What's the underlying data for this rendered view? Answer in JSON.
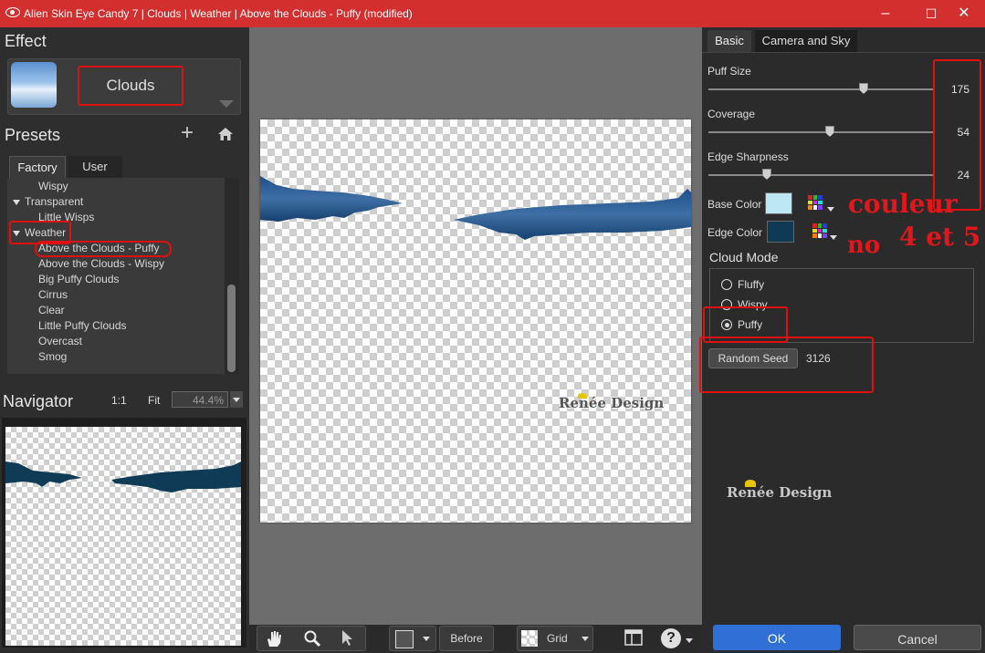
{
  "window": {
    "title": "Alien Skin Eye Candy 7 | Clouds | Weather | Above the Clouds - Puffy (modified)",
    "minimize": "–",
    "maximize": "☐",
    "close": "✕"
  },
  "left": {
    "effect_header": "Effect",
    "effect_name": "Clouds",
    "presets_header": "Presets",
    "presets_add": "+",
    "tabs": [
      "Factory",
      "User"
    ],
    "tree": [
      {
        "label": "Wispy",
        "level": 1
      },
      {
        "label": "Transparent",
        "level": 0
      },
      {
        "label": "Little Wisps",
        "level": 1
      },
      {
        "label": "Weather",
        "level": 0
      },
      {
        "label": "Above the Clouds - Puffy",
        "level": 1
      },
      {
        "label": "Above the Clouds - Wispy",
        "level": 1
      },
      {
        "label": "Big Puffy Clouds",
        "level": 1
      },
      {
        "label": "Cirrus",
        "level": 1
      },
      {
        "label": "Clear",
        "level": 1
      },
      {
        "label": "Little Puffy Clouds",
        "level": 1
      },
      {
        "label": "Overcast",
        "level": 1
      },
      {
        "label": "Smog",
        "level": 1
      }
    ],
    "navigator_header": "Navigator",
    "zoom_1to1": "1:1",
    "zoom_fit": "Fit",
    "zoom_value": "44.4%"
  },
  "canvas": {
    "watermark": "Renée Design"
  },
  "bottom": {
    "before_label": "Before",
    "grid_label": "Grid",
    "help": "?"
  },
  "right": {
    "tabs": [
      "Basic",
      "Camera and Sky"
    ],
    "sliders": [
      {
        "label": "Puff Size",
        "value": 175,
        "fraction": 0.68
      },
      {
        "label": "Coverage",
        "value": 54,
        "fraction": 0.54
      },
      {
        "label": "Edge Sharpness",
        "value": 24,
        "fraction": 0.26
      }
    ],
    "base_color_label": "Base Color",
    "base_color": "#bfe6f5",
    "edge_color_label": "Edge Color",
    "edge_color": "#0e3a56",
    "cloud_mode_header": "Cloud Mode",
    "cloud_modes": [
      "Fluffy",
      "Wispy",
      "Puffy"
    ],
    "cloud_mode_selected": "Puffy",
    "random_seed_label": "Random Seed",
    "random_seed_value": "3126",
    "watermark": "Renée Design",
    "ok_label": "OK",
    "cancel_label": "Cancel"
  },
  "annotation": {
    "line1": "couleur",
    "line2a": "no",
    "line2b": "4 et 5"
  },
  "colors": {
    "titlebar": "#d32f2f",
    "highlight": "#e01010",
    "ok_button": "#2f6fd6"
  }
}
